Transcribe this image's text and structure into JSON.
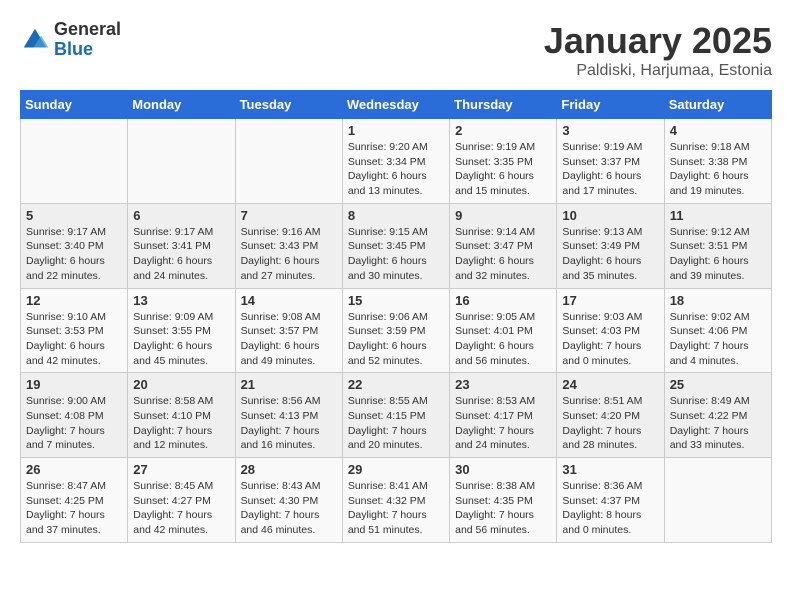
{
  "header": {
    "logo_general": "General",
    "logo_blue": "Blue",
    "title": "January 2025",
    "subtitle": "Paldiski, Harjumaa, Estonia"
  },
  "weekdays": [
    "Sunday",
    "Monday",
    "Tuesday",
    "Wednesday",
    "Thursday",
    "Friday",
    "Saturday"
  ],
  "weeks": [
    [
      {
        "day": "",
        "info": ""
      },
      {
        "day": "",
        "info": ""
      },
      {
        "day": "",
        "info": ""
      },
      {
        "day": "1",
        "info": "Sunrise: 9:20 AM\nSunset: 3:34 PM\nDaylight: 6 hours\nand 13 minutes."
      },
      {
        "day": "2",
        "info": "Sunrise: 9:19 AM\nSunset: 3:35 PM\nDaylight: 6 hours\nand 15 minutes."
      },
      {
        "day": "3",
        "info": "Sunrise: 9:19 AM\nSunset: 3:37 PM\nDaylight: 6 hours\nand 17 minutes."
      },
      {
        "day": "4",
        "info": "Sunrise: 9:18 AM\nSunset: 3:38 PM\nDaylight: 6 hours\nand 19 minutes."
      }
    ],
    [
      {
        "day": "5",
        "info": "Sunrise: 9:17 AM\nSunset: 3:40 PM\nDaylight: 6 hours\nand 22 minutes."
      },
      {
        "day": "6",
        "info": "Sunrise: 9:17 AM\nSunset: 3:41 PM\nDaylight: 6 hours\nand 24 minutes."
      },
      {
        "day": "7",
        "info": "Sunrise: 9:16 AM\nSunset: 3:43 PM\nDaylight: 6 hours\nand 27 minutes."
      },
      {
        "day": "8",
        "info": "Sunrise: 9:15 AM\nSunset: 3:45 PM\nDaylight: 6 hours\nand 30 minutes."
      },
      {
        "day": "9",
        "info": "Sunrise: 9:14 AM\nSunset: 3:47 PM\nDaylight: 6 hours\nand 32 minutes."
      },
      {
        "day": "10",
        "info": "Sunrise: 9:13 AM\nSunset: 3:49 PM\nDaylight: 6 hours\nand 35 minutes."
      },
      {
        "day": "11",
        "info": "Sunrise: 9:12 AM\nSunset: 3:51 PM\nDaylight: 6 hours\nand 39 minutes."
      }
    ],
    [
      {
        "day": "12",
        "info": "Sunrise: 9:10 AM\nSunset: 3:53 PM\nDaylight: 6 hours\nand 42 minutes."
      },
      {
        "day": "13",
        "info": "Sunrise: 9:09 AM\nSunset: 3:55 PM\nDaylight: 6 hours\nand 45 minutes."
      },
      {
        "day": "14",
        "info": "Sunrise: 9:08 AM\nSunset: 3:57 PM\nDaylight: 6 hours\nand 49 minutes."
      },
      {
        "day": "15",
        "info": "Sunrise: 9:06 AM\nSunset: 3:59 PM\nDaylight: 6 hours\nand 52 minutes."
      },
      {
        "day": "16",
        "info": "Sunrise: 9:05 AM\nSunset: 4:01 PM\nDaylight: 6 hours\nand 56 minutes."
      },
      {
        "day": "17",
        "info": "Sunrise: 9:03 AM\nSunset: 4:03 PM\nDaylight: 7 hours\nand 0 minutes."
      },
      {
        "day": "18",
        "info": "Sunrise: 9:02 AM\nSunset: 4:06 PM\nDaylight: 7 hours\nand 4 minutes."
      }
    ],
    [
      {
        "day": "19",
        "info": "Sunrise: 9:00 AM\nSunset: 4:08 PM\nDaylight: 7 hours\nand 7 minutes."
      },
      {
        "day": "20",
        "info": "Sunrise: 8:58 AM\nSunset: 4:10 PM\nDaylight: 7 hours\nand 12 minutes."
      },
      {
        "day": "21",
        "info": "Sunrise: 8:56 AM\nSunset: 4:13 PM\nDaylight: 7 hours\nand 16 minutes."
      },
      {
        "day": "22",
        "info": "Sunrise: 8:55 AM\nSunset: 4:15 PM\nDaylight: 7 hours\nand 20 minutes."
      },
      {
        "day": "23",
        "info": "Sunrise: 8:53 AM\nSunset: 4:17 PM\nDaylight: 7 hours\nand 24 minutes."
      },
      {
        "day": "24",
        "info": "Sunrise: 8:51 AM\nSunset: 4:20 PM\nDaylight: 7 hours\nand 28 minutes."
      },
      {
        "day": "25",
        "info": "Sunrise: 8:49 AM\nSunset: 4:22 PM\nDaylight: 7 hours\nand 33 minutes."
      }
    ],
    [
      {
        "day": "26",
        "info": "Sunrise: 8:47 AM\nSunset: 4:25 PM\nDaylight: 7 hours\nand 37 minutes."
      },
      {
        "day": "27",
        "info": "Sunrise: 8:45 AM\nSunset: 4:27 PM\nDaylight: 7 hours\nand 42 minutes."
      },
      {
        "day": "28",
        "info": "Sunrise: 8:43 AM\nSunset: 4:30 PM\nDaylight: 7 hours\nand 46 minutes."
      },
      {
        "day": "29",
        "info": "Sunrise: 8:41 AM\nSunset: 4:32 PM\nDaylight: 7 hours\nand 51 minutes."
      },
      {
        "day": "30",
        "info": "Sunrise: 8:38 AM\nSunset: 4:35 PM\nDaylight: 7 hours\nand 56 minutes."
      },
      {
        "day": "31",
        "info": "Sunrise: 8:36 AM\nSunset: 4:37 PM\nDaylight: 8 hours\nand 0 minutes."
      },
      {
        "day": "",
        "info": ""
      }
    ]
  ]
}
